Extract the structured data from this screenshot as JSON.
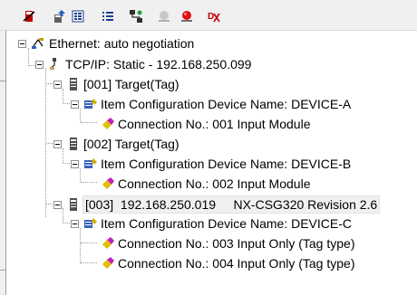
{
  "toolbar": {
    "icons": [
      "delete-icon",
      "upload-device-icon",
      "device-list-icon",
      "list-icon",
      "network-config-icon",
      "offline-icon",
      "online-icon",
      "check-icon"
    ]
  },
  "tree": {
    "root": "Ethernet: auto negotiation",
    "tcpip": "TCP/IP: Static - 192.168.250.099",
    "targets": [
      {
        "label": "[001] Target(Tag)",
        "item_config": "Item Configuration  Device Name: DEVICE-A",
        "connections": [
          "Connection No.: 001  Input Module"
        ]
      },
      {
        "label": "[002] Target(Tag)",
        "item_config": "Item Configuration  Device Name: DEVICE-B",
        "connections": [
          "Connection No.: 002  Input Module"
        ]
      },
      {
        "label": "[003]  192.168.250.019     NX-CSG320 Revision 2.6",
        "item_config": "Item Configuration  Device Name: DEVICE-C",
        "connections": [
          "Connection No.: 003 Input Only (Tag type)",
          "Connection No.: 004 Input Only (Tag type)"
        ]
      }
    ]
  }
}
